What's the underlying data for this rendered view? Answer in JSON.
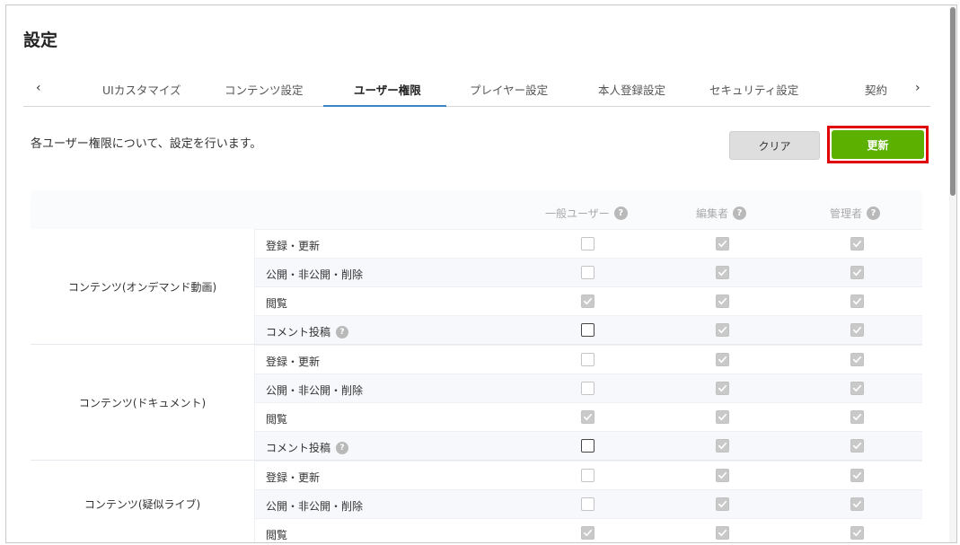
{
  "page": {
    "title": "設定",
    "description": "各ユーザー権限について、設定を行います。"
  },
  "tabs": {
    "prev_arrow": "‹",
    "next_arrow": "›",
    "items": [
      {
        "label": "UIカスタマイズ",
        "active": false
      },
      {
        "label": "コンテンツ設定",
        "active": false
      },
      {
        "label": "ユーザー権限",
        "active": true
      },
      {
        "label": "プレイヤー設定",
        "active": false
      },
      {
        "label": "本人登録設定",
        "active": false
      },
      {
        "label": "セキュリティ設定",
        "active": false
      },
      {
        "label": "契約",
        "active": false
      }
    ]
  },
  "buttons": {
    "clear": "クリア",
    "update": "更新"
  },
  "table": {
    "columns": [
      "一般ユーザー",
      "編集者",
      "管理者"
    ],
    "help_glyph": "?",
    "groups": [
      {
        "label": "コンテンツ(オンデマンド動画)",
        "rows": [
          {
            "label": "登録・更新",
            "help": false,
            "values": [
              false,
              true,
              true
            ]
          },
          {
            "label": "公開・非公開・削除",
            "help": false,
            "values": [
              false,
              true,
              true
            ]
          },
          {
            "label": "閲覧",
            "help": false,
            "values": [
              true,
              true,
              true
            ]
          },
          {
            "label": "コメント投稿",
            "help": true,
            "values": [
              false,
              true,
              true
            ]
          }
        ]
      },
      {
        "label": "コンテンツ(ドキュメント)",
        "rows": [
          {
            "label": "登録・更新",
            "help": false,
            "values": [
              false,
              true,
              true
            ]
          },
          {
            "label": "公開・非公開・削除",
            "help": false,
            "values": [
              false,
              true,
              true
            ]
          },
          {
            "label": "閲覧",
            "help": false,
            "values": [
              true,
              true,
              true
            ]
          },
          {
            "label": "コメント投稿",
            "help": true,
            "values": [
              false,
              true,
              true
            ]
          }
        ]
      },
      {
        "label": "コンテンツ(疑似ライブ)",
        "rows": [
          {
            "label": "登録・更新",
            "help": false,
            "values": [
              false,
              true,
              true
            ]
          },
          {
            "label": "公開・非公開・削除",
            "help": false,
            "values": [
              false,
              true,
              true
            ]
          },
          {
            "label": "閲覧",
            "help": false,
            "values": [
              true,
              true,
              true
            ]
          }
        ]
      }
    ]
  },
  "colors": {
    "accent_tab": "#3a85c6",
    "update_button": "#5cb000",
    "highlight_border": "#e00000"
  }
}
